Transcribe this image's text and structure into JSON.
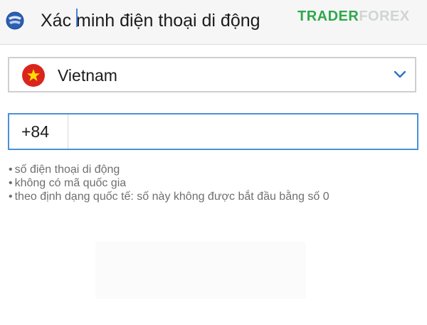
{
  "header": {
    "title": "Xác minh điện thoại di động",
    "logo_icon": "globe-logo-icon"
  },
  "watermark": {
    "part1": "TRADER",
    "part2": "FOREX",
    "color1": "#2fa84a",
    "color2": "#cfd6d0"
  },
  "country": {
    "selected": "Vietnam",
    "flag_icon": "vietnam-flag-icon",
    "dropdown_icon": "chevron-down-icon"
  },
  "phone": {
    "prefix": "+84",
    "value": "",
    "focus_color": "#4a90d9"
  },
  "hints": [
    "số điện thoại di động",
    "không có mã quốc gia",
    "theo định dạng quốc tế: số này không được bắt đầu bằng số 0"
  ]
}
